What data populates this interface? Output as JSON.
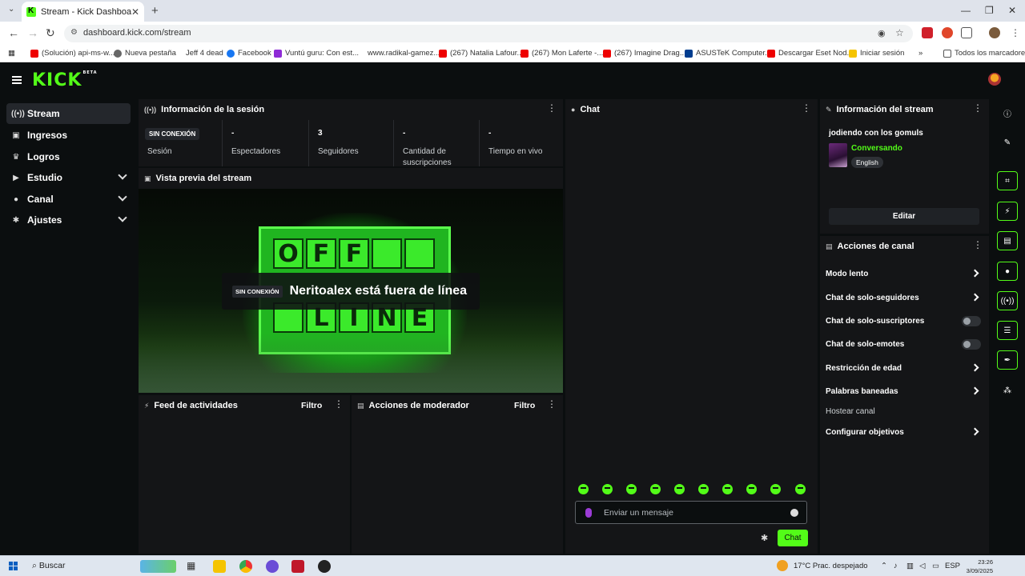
{
  "browser": {
    "tab_title": "Stream - Kick Dashboard",
    "url": "dashboard.kick.com/stream",
    "bookmarks": [
      "(Solución) api-ms-w...",
      "Nueva pestaña",
      "Jeff 4 dead",
      "Facebook",
      "Vuntú guru: Con est...",
      "www.radikal-gamez...",
      "(267) Natalia Lafour...",
      "(267) Mon Laferte -...",
      "(267) Imagine Drag...",
      "ASUSTeK Computer...",
      "Descargar Eset Nod...",
      "Iniciar sesión",
      "Todos los marcadores"
    ]
  },
  "app": {
    "logo": "KICK",
    "logo_tag": "BETA"
  },
  "sidebar": {
    "items": [
      {
        "label": "Stream",
        "icon": "broadcast-icon"
      },
      {
        "label": "Ingresos",
        "icon": "wallet-icon"
      },
      {
        "label": "Logros",
        "icon": "trophy-icon"
      },
      {
        "label": "Estudio",
        "icon": "camera-icon"
      },
      {
        "label": "Canal",
        "icon": "person-icon"
      },
      {
        "label": "Ajustes",
        "icon": "gear-icon"
      }
    ]
  },
  "session": {
    "title": "Información de la sesión",
    "status_badge": "SIN CONEXIÓN",
    "status_label": "Sesión",
    "stats": [
      {
        "value": "-",
        "label": "Espectadores"
      },
      {
        "value": "3",
        "label": "Seguidores"
      },
      {
        "value": "-",
        "label": "Cantidad de suscripciones"
      },
      {
        "value": "-",
        "label": "Tiempo en vivo"
      }
    ]
  },
  "preview": {
    "title": "Vista previa del stream",
    "sign_top": [
      "O",
      "F",
      "F",
      "",
      ""
    ],
    "sign_bottom": [
      "",
      "L",
      "I",
      "N",
      "E"
    ],
    "badge": "SIN CONEXIÓN",
    "message": "Neritoalex está fuera de línea"
  },
  "activity": {
    "title": "Feed de actividades",
    "filter": "Filtro"
  },
  "moderator": {
    "title": "Acciones de moderador",
    "filter": "Filtro"
  },
  "chat": {
    "title": "Chat",
    "placeholder": "Enviar un mensaje",
    "send_label": "Chat"
  },
  "stream_info": {
    "title": "Información del stream",
    "stream_title": "jodiendo con los gomuls",
    "category": "Conversando",
    "language": "English",
    "edit_label": "Editar"
  },
  "channel_actions": {
    "title": "Acciones de canal",
    "items": [
      {
        "label": "Modo lento",
        "control": "arrow"
      },
      {
        "label": "Chat de solo-seguidores",
        "control": "arrow"
      },
      {
        "label": "Chat de solo-suscriptores",
        "control": "toggle",
        "enabled": false
      },
      {
        "label": "Chat de solo-emotes",
        "control": "toggle",
        "enabled": false
      },
      {
        "label": "Restricción de edad",
        "control": "arrow"
      },
      {
        "label": "Palabras baneadas",
        "control": "arrow"
      },
      {
        "label": "Hostear canal",
        "control": "none"
      },
      {
        "label": "Configurar objetivos",
        "control": "arrow"
      }
    ]
  },
  "taskbar": {
    "search": "Buscar",
    "weather": "17°C  Prac. despejado",
    "lang": "ESP",
    "time": "23:26",
    "date": "3/09/2025"
  },
  "colors": {
    "accent": "#53fc18",
    "panel": "#141517",
    "bg": "#0b0e0f"
  }
}
